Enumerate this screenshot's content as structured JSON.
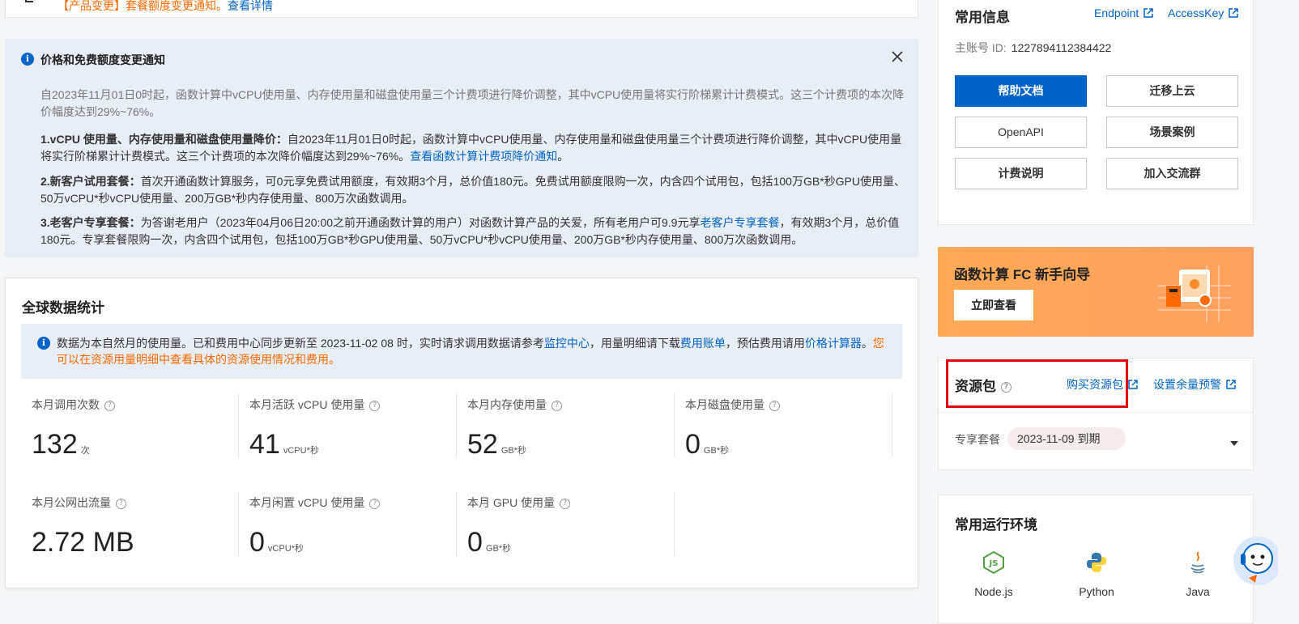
{
  "top_card": {
    "text": "【产品变更】套餐额度变更通知。",
    "link": "查看详情"
  },
  "notice": {
    "title": "价格和免费额度变更通知",
    "intro": "自2023年11月01日0时起，函数计算中vCPU使用量、内存使用量和磁盘使用量三个计费项进行降价调整，其中vCPU使用量将实行阶梯累计计费模式。这三个计费项的本次降价幅度达到29%~76%。",
    "item1_bold": "1.vCPU 使用量、内存使用量和磁盘使用量降价：",
    "item1_text": "自2023年11月01日0时起，函数计算中vCPU使用量、内存使用量和磁盘使用量三个计费项进行降价调整，其中vCPU使用量将实行阶梯累计计费模式。这三个计费项的本次降价幅度达到29%~76%。",
    "item1_link": "查看函数计算计费项降价通知",
    "item1_end": "。",
    "item2_bold": "2.新客户试用套餐：",
    "item2_text": "首次开通函数计算服务，可0元享免费试用额度，有效期3个月，总价值180元。免费试用额度限购一次，内含四个试用包，包括100万GB*秒GPU使用量、50万vCPU*秒vCPU使用量、200万GB*秒内存使用量、800万次函数调用。",
    "item3_bold": "3.老客户专享套餐：",
    "item3_text_a": "为答谢老用户（2023年04月06日20:00之前开通函数计算的用户）对函数计算产品的关爱，所有老用户可9.9元享",
    "item3_link": "老客户专享套餐",
    "item3_text_b": "，有效期3个月，总价值180元。专享套餐限购一次，内含四个试用包，包括100万GB*秒GPU使用量、50万vCPU*秒vCPU使用量、200万GB*秒内存使用量、800万次函数调用。"
  },
  "stats": {
    "title": "全球数据统计",
    "info_a": "数据为本自然月的使用量。已和费用中心同步更新至 2023-11-02 08 时，实时请求调用数据请参考",
    "info_link1": "监控中心",
    "info_b": "，用量明细请下载",
    "info_link2": "费用账单",
    "info_c": "，预估费用请用",
    "info_link3": "价格计算器",
    "info_d": "。",
    "info_orange_a": "您可以在",
    "info_link4": "资源用量明细",
    "info_orange_b": "中查看具体的资源使用情况和费用。",
    "metrics": [
      {
        "label": "本月调用次数",
        "value": "132",
        "unit": "次"
      },
      {
        "label": "本月活跃 vCPU 使用量",
        "value": "41",
        "unit": "vCPU*秒"
      },
      {
        "label": "本月内存使用量",
        "value": "52",
        "unit": "GB*秒"
      },
      {
        "label": "本月磁盘使用量",
        "value": "0",
        "unit": "GB*秒"
      },
      {
        "label": "本月公网出流量",
        "value": "2.72 MB",
        "unit": ""
      },
      {
        "label": "本月闲置 vCPU 使用量",
        "value": "0",
        "unit": "vCPU*秒"
      },
      {
        "label": "本月 GPU 使用量",
        "value": "0",
        "unit": "GB*秒"
      }
    ]
  },
  "common_info": {
    "title": "常用信息",
    "endpoint": "Endpoint",
    "accesskey": "AccessKey",
    "account_label": "主账号 ID:",
    "account_id": "1227894112384422",
    "buttons": [
      "帮助文档",
      "迁移上云",
      "OpenAPI",
      "场景案例",
      "计费说明",
      "加入交流群"
    ]
  },
  "guide": {
    "title": "函数计算 FC 新手向导",
    "button": "立即查看"
  },
  "resource_pack": {
    "title": "资源包",
    "buy": "购买资源包",
    "alert": "设置余量预警",
    "row_label": "专享套餐",
    "expire": "2023-11-09 到期"
  },
  "runtime": {
    "title": "常用运行环境",
    "items": [
      "Node.js",
      "Python",
      "Java"
    ]
  },
  "colors": {
    "primary": "#0064c8",
    "orange": "#ff6a00",
    "highlight": "#e60012"
  }
}
